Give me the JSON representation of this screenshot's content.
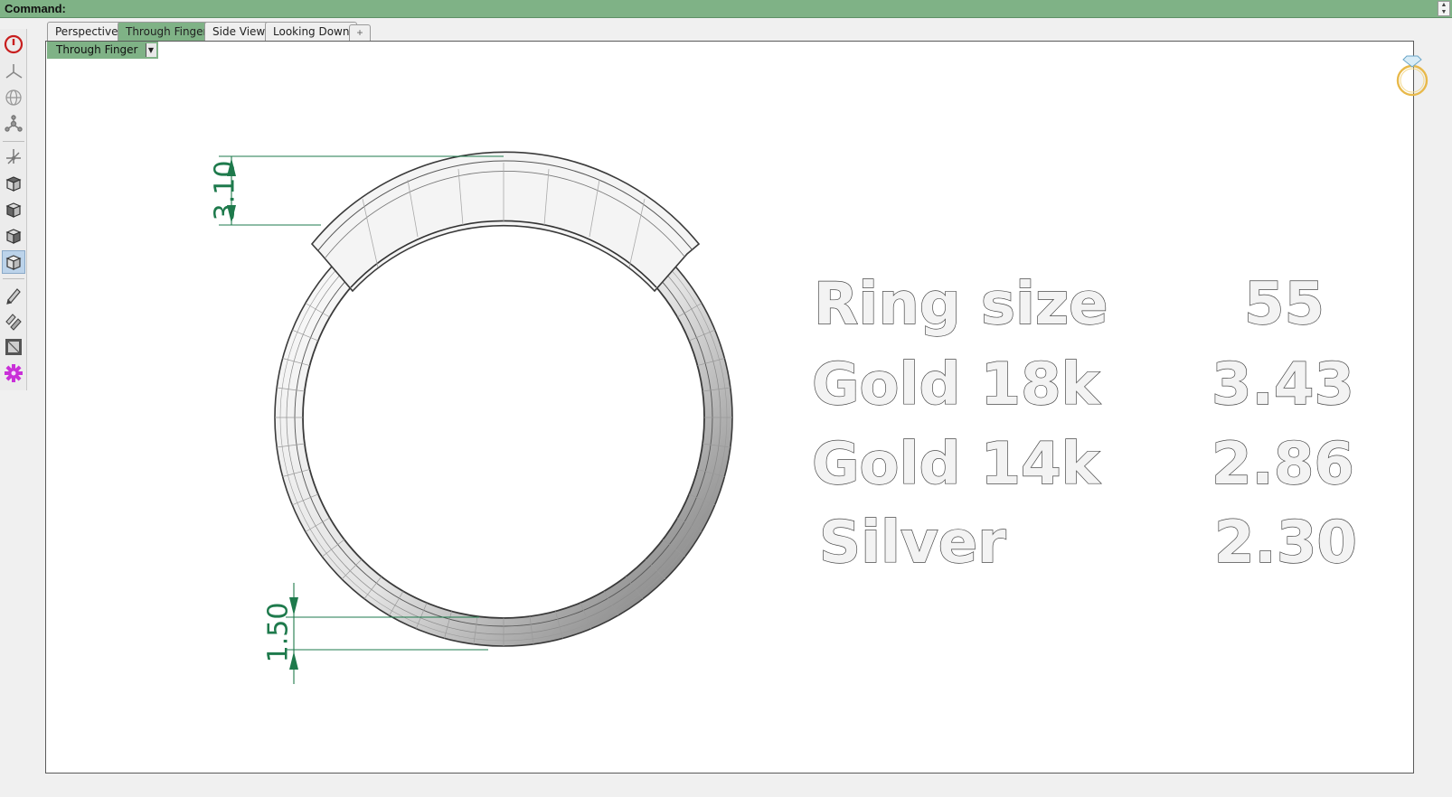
{
  "command": {
    "label": "Command:"
  },
  "tabs": [
    {
      "label": "Perspective"
    },
    {
      "label": "Through Finger"
    },
    {
      "label": "Side View"
    },
    {
      "label": "Looking Down"
    }
  ],
  "tab_add_icon": "plus-icon",
  "viewport": {
    "title": "Through Finger",
    "dimensions": {
      "top": "3.10",
      "bottom": "1.50"
    },
    "table": {
      "rows": [
        {
          "label": "Ring size",
          "value": "55"
        },
        {
          "label": "Gold 18k",
          "value": "3.43"
        },
        {
          "label": "Gold 14k",
          "value": "2.86"
        },
        {
          "label": "Silver",
          "value": "2.30"
        }
      ]
    }
  },
  "toolbar": {
    "icons": [
      "power-icon",
      "axes-icon",
      "globe-icon",
      "nodes-icon",
      "gumball-icon",
      "cube-top-icon",
      "cube-front-icon",
      "cube-right-icon",
      "cube-perspective-icon",
      "pen-icon",
      "multi-pen-icon",
      "render-frame-icon",
      "gear-icon"
    ]
  },
  "colors": {
    "accent": "#7fb286",
    "dimension": "#1e7a4c",
    "ring_icon": "#e8b94a"
  }
}
